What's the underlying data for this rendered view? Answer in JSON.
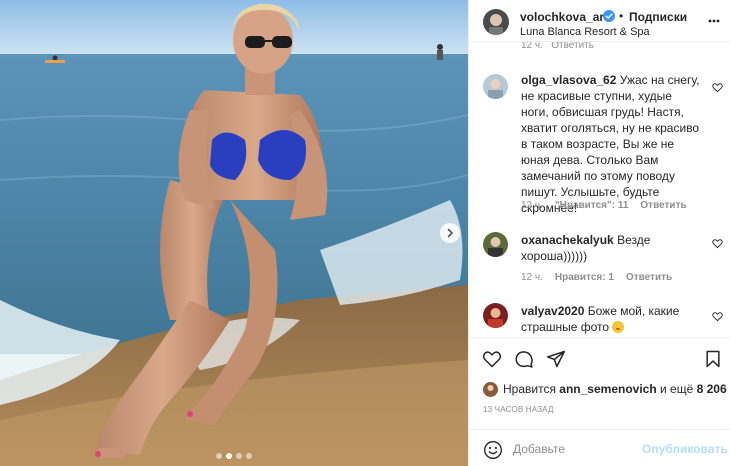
{
  "post": {
    "username": "volochkova_art",
    "follow_label": "Подписки",
    "location": "Luna Blanca Resort & Spa",
    "verified": true,
    "carousel": {
      "count": 4,
      "active": 2
    }
  },
  "comments": [
    {
      "username": "olga_vlasova_62",
      "text": "Ужас на снегу, не красивые ступни, худые ноги, обвисшая грудь! Настя, хватит оголяться, ну не красиво в таком возрасте, Вы же не юная дева. Столько Вам замечаний по этому поводу пишут. Услышьте, будьте скромнее!",
      "time": "12 ч.",
      "likes": "\"Нравится\": 11",
      "reply": "Ответить"
    },
    {
      "username": "oxanachekalyuk",
      "text": "Везде хороша))))))",
      "time": "12 ч.",
      "likes": "Нравится: 1",
      "reply": "Ответить"
    },
    {
      "username": "valyav2020",
      "text": "Боже мой, какие страшные фото",
      "emoji": "slightly-frowning-face"
    }
  ],
  "likes": {
    "prefix": "Нравится",
    "user": "ann_semenovich",
    "middle": "и ещё",
    "count": "8 206"
  },
  "timestamp": "13 ЧАСОВ НАЗАД",
  "add_comment": {
    "placeholder": "Добавьте",
    "publish_label": "Опубликовать"
  },
  "icons": {
    "verified": "verified-badge-icon",
    "close": "close-icon",
    "like": "heart-icon",
    "comment": "comment-bubble-icon",
    "share": "paper-plane-icon",
    "save": "bookmark-icon",
    "emoji": "smile-icon",
    "next": "chevron-right-icon"
  },
  "colors": {
    "verified": "#3897f0",
    "text": "#262626",
    "muted": "#8e8e8e",
    "publish_disabled": "#b2dffc",
    "border": "#efefef"
  }
}
